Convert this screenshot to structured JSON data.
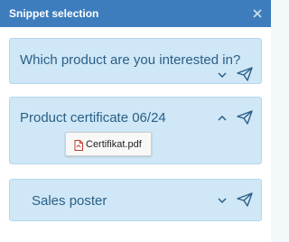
{
  "window": {
    "title": "Snippet selection",
    "close_icon": "close-icon"
  },
  "snippets": [
    {
      "label": "Which product are you interested in?",
      "expanded": false
    },
    {
      "label": "Product certificate 06/24",
      "expanded": true,
      "attachments": [
        {
          "name": "Certifikat.pdf",
          "icon": "pdf-file-icon"
        }
      ]
    },
    {
      "label": "Sales poster",
      "expanded": false
    }
  ],
  "colors": {
    "titlebar": "#3d7dbd",
    "card_bg": "#cfe7f6",
    "card_border": "#b4d6ec",
    "text": "#2b5f87"
  }
}
